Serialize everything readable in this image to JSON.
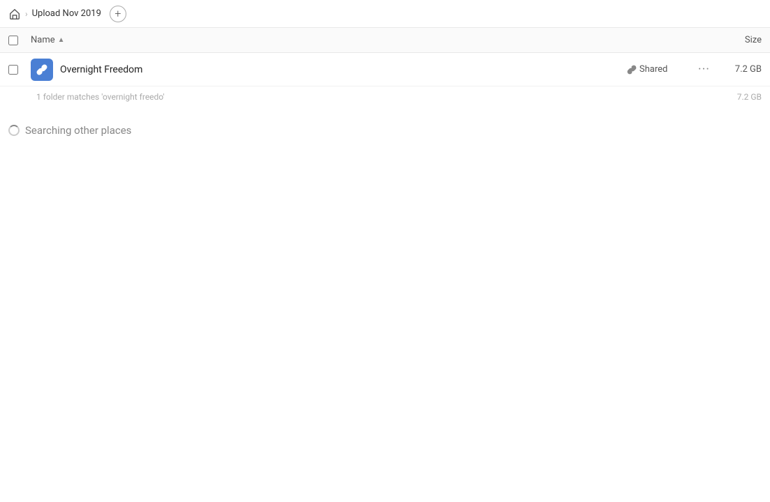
{
  "breadcrumb": {
    "home_label": "Home",
    "folder_name": "Upload Nov 2019",
    "add_button_label": "+"
  },
  "columns": {
    "name_label": "Name",
    "sort_indicator": "▲",
    "size_label": "Size"
  },
  "file_row": {
    "name": "Overnight Freedom",
    "shared_label": "Shared",
    "size": "7.2 GB",
    "more_label": "···"
  },
  "match_row": {
    "text": "1 folder matches 'overnight freedo'",
    "size": "7.2 GB"
  },
  "searching_row": {
    "label": "Searching other places"
  }
}
